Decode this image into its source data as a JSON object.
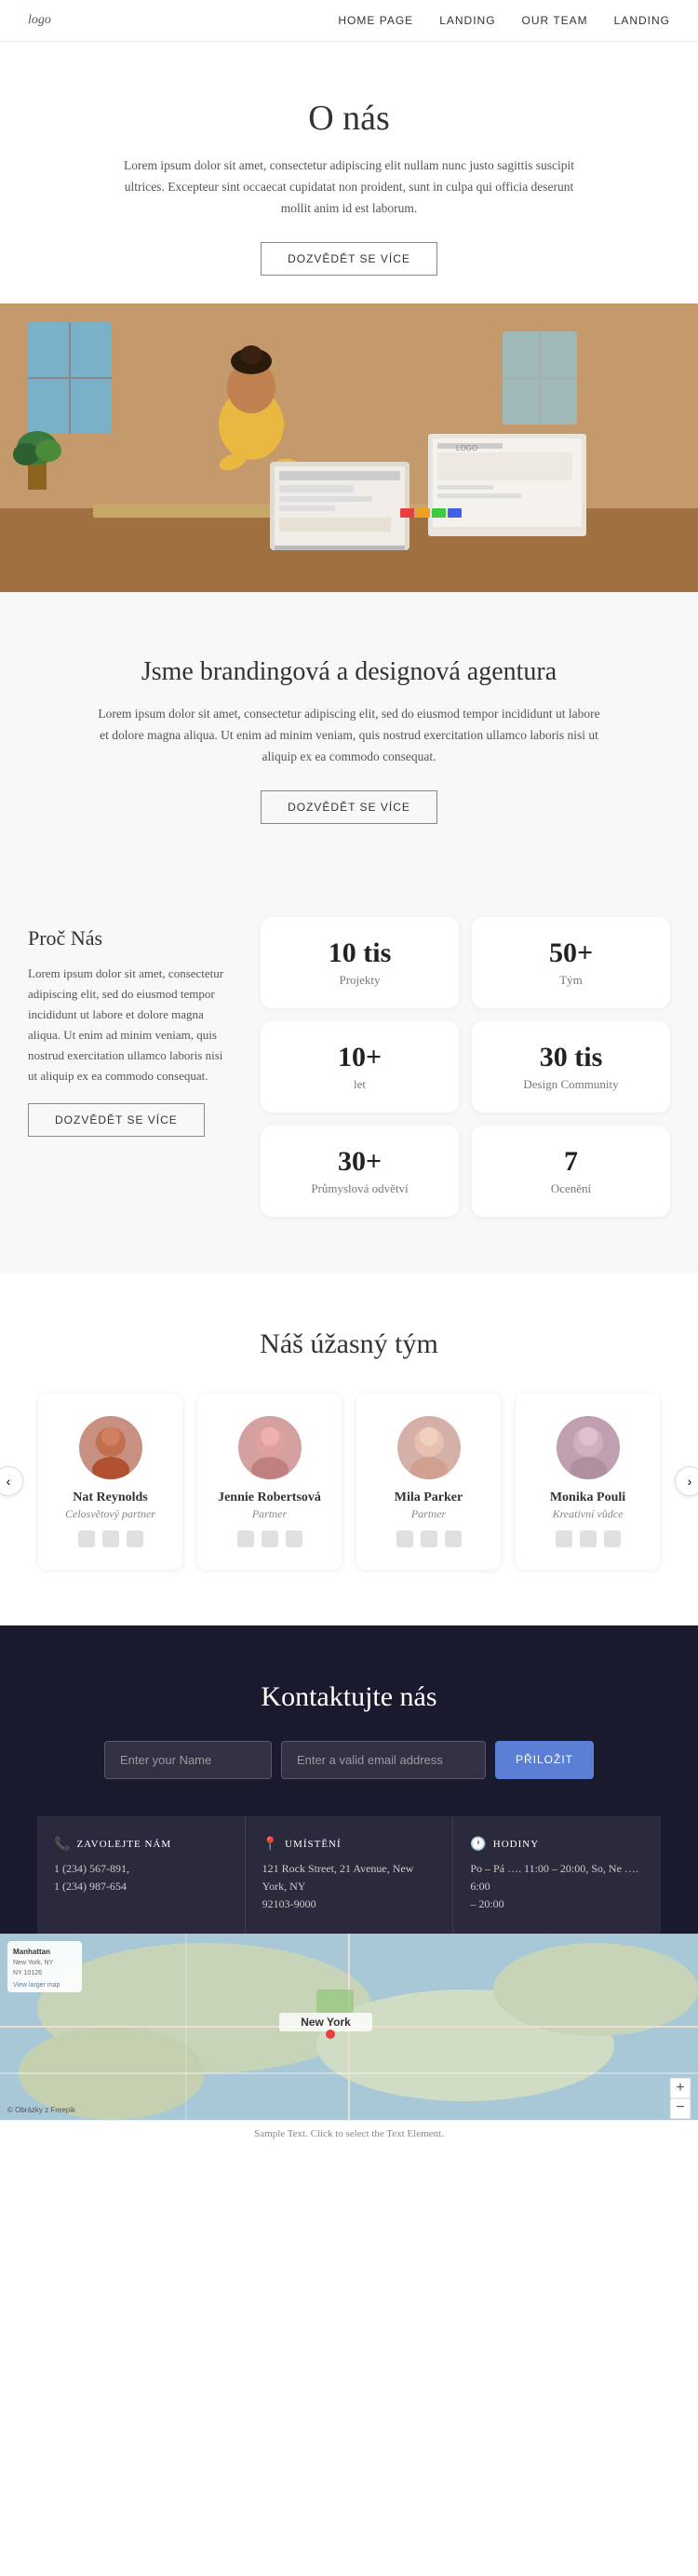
{
  "nav": {
    "logo": "logo",
    "links": [
      "HOME PAGE",
      "LANDING",
      "OUR TEAM",
      "LANDING"
    ]
  },
  "about": {
    "title": "O nás",
    "body": "Lorem ipsum dolor sit amet, consectetur adipiscing elit nullam nunc justo sagittis suscipit ultrices. Excepteur sint occaecat cupidatat non proident, sunt in culpa qui officia deserunt mollit anim id est laborum.",
    "btn": "DOZVĚDĚT SE VÍCE"
  },
  "branding": {
    "title": "Jsme brandingová a designová agentura",
    "body": "Lorem ipsum dolor sit amet, consectetur adipiscing elit, sed do eiusmod tempor incididunt ut labore et dolore magna aliqua. Ut enim ad minim veniam, quis nostrud exercitation ullamco laboris nisi ut aliquip ex ea commodo consequat.",
    "btn": "DOZVĚDĚT SE VÍCE"
  },
  "stats_section": {
    "title": "Proč Nás",
    "body": "Lorem ipsum dolor sit amet, consectetur adipiscing elit, sed do eiusmod tempor incididunt ut labore et dolore magna aliqua. Ut enim ad minim veniam, quis nostrud exercitation ullamco laboris nisi ut aliquip ex ea commodo consequat.",
    "btn": "DOZVĚDĚT SE VÍCE",
    "cards": [
      {
        "number": "10 tis",
        "label": "Projekty"
      },
      {
        "number": "50+",
        "label": "Tým"
      },
      {
        "number": "10+",
        "label": "let"
      },
      {
        "number": "30 tis",
        "label": "Design Community"
      },
      {
        "number": "30+",
        "label": "Průmyslová odvětví"
      },
      {
        "number": "7",
        "label": "Ocenění"
      }
    ]
  },
  "team": {
    "title": "Náš úžasný tým",
    "members": [
      {
        "name": "Nat Reynolds",
        "role": "Celosvětový partner",
        "color": "#c89080"
      },
      {
        "name": "Jennie Robertsová",
        "role": "Partner",
        "color": "#c89090"
      },
      {
        "name": "Mila Parker",
        "role": "Partner",
        "color": "#d4a8a0"
      },
      {
        "name": "Monika Pouli",
        "role": "Kreativní vůdce",
        "color": "#c0a0b0"
      }
    ],
    "prev_btn": "‹",
    "next_btn": "›"
  },
  "contact": {
    "title": "Kontaktujte nás",
    "name_placeholder": "Enter your Name",
    "email_placeholder": "Enter a valid email address",
    "submit_btn": "PŘILOŽIT",
    "info_boxes": [
      {
        "icon": "📞",
        "title": "ZAVOLEJTE NÁM",
        "lines": [
          "1 (234) 567-891,",
          "1 (234) 987-654"
        ]
      },
      {
        "icon": "📍",
        "title": "UMÍSTĚNÍ",
        "lines": [
          "121 Rock Street, 21 Avenue, New York, NY",
          "92103-9000"
        ]
      },
      {
        "icon": "🕐",
        "title": "HODINY",
        "lines": [
          "Po – Pá …. 11:00 – 20:00, So, Ne …. 6:00",
          "– 20:00"
        ]
      }
    ]
  },
  "map": {
    "label": "New York",
    "zoom_in": "+",
    "zoom_out": "−",
    "attribution": "© Obráky z Freepik"
  },
  "footer": {
    "text": "Sample Text. Click to select the Text Element."
  }
}
